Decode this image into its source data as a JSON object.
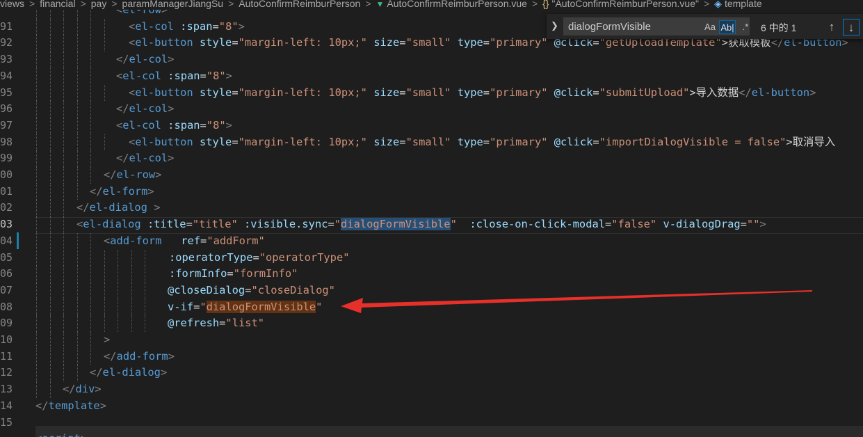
{
  "breadcrumb": {
    "items": [
      "views",
      "financial",
      "pay",
      "paramManagerJiangSu",
      "AutoConfirmReimburPerson",
      "AutoConfirmReimburPerson.vue",
      "\"AutoConfirmReimburPerson.vue\"",
      "template"
    ],
    "separator": ">"
  },
  "gutter": {
    "line_numbers": [
      "91",
      "92",
      "93",
      "94",
      "95",
      "96",
      "97",
      "98",
      "99",
      "00",
      "01",
      "02",
      "03",
      "04",
      "05",
      "06",
      "07",
      "08",
      "09",
      "10",
      "11",
      "12",
      "13",
      "14",
      "15"
    ],
    "active_line": "03"
  },
  "find_widget": {
    "toggle_icon": "chevron-right-icon",
    "query": "dialogFormVisible",
    "match_case_label": "Aa",
    "whole_word_label": "Ab|",
    "regex_label": ".*",
    "result_count": "6 中的 1",
    "prev_icon": "arrow-up-icon",
    "next_icon": "arrow-down-icon"
  },
  "annotation": {
    "type": "red-arrow",
    "color": "#e8302a"
  },
  "code_lines": [
    {
      "tokens": [
        {
          "c": "p",
          "t": "<"
        },
        {
          "c": "t",
          "t": "el-row"
        },
        {
          "c": "p",
          "t": ">"
        }
      ]
    },
    {
      "tokens": [
        {
          "c": "p",
          "t": "<"
        },
        {
          "c": "t",
          "t": "el-col"
        },
        {
          "c": "x",
          "t": " "
        },
        {
          "c": "a",
          "t": ":span"
        },
        {
          "c": "x",
          "t": "="
        },
        {
          "c": "s",
          "t": "\"8\""
        },
        {
          "c": "p",
          "t": ">"
        }
      ]
    },
    {
      "tokens": [
        {
          "c": "p",
          "t": "<"
        },
        {
          "c": "t",
          "t": "el-button"
        },
        {
          "c": "x",
          "t": " "
        },
        {
          "c": "a",
          "t": "style"
        },
        {
          "c": "x",
          "t": "="
        },
        {
          "c": "s",
          "t": "\"margin-left: 10px;\""
        },
        {
          "c": "x",
          "t": " "
        },
        {
          "c": "a",
          "t": "size"
        },
        {
          "c": "x",
          "t": "="
        },
        {
          "c": "s",
          "t": "\"small\""
        },
        {
          "c": "x",
          "t": " "
        },
        {
          "c": "a",
          "t": "type"
        },
        {
          "c": "x",
          "t": "="
        },
        {
          "c": "s",
          "t": "\"primary\""
        },
        {
          "c": "x",
          "t": " "
        },
        {
          "c": "a",
          "t": "@click"
        },
        {
          "c": "x",
          "t": "="
        },
        {
          "c": "s",
          "t": "\"getUploadTemplate\""
        },
        {
          "c": "x",
          "t": ">获取模板"
        },
        {
          "c": "p",
          "t": "</"
        },
        {
          "c": "t",
          "t": "el-button"
        },
        {
          "c": "p",
          "t": ">"
        }
      ]
    },
    {
      "tokens": [
        {
          "c": "p",
          "t": "</"
        },
        {
          "c": "t",
          "t": "el-col"
        },
        {
          "c": "p",
          "t": ">"
        }
      ]
    },
    {
      "tokens": [
        {
          "c": "p",
          "t": "<"
        },
        {
          "c": "t",
          "t": "el-col"
        },
        {
          "c": "x",
          "t": " "
        },
        {
          "c": "a",
          "t": ":span"
        },
        {
          "c": "x",
          "t": "="
        },
        {
          "c": "s",
          "t": "\"8\""
        },
        {
          "c": "p",
          "t": ">"
        }
      ]
    },
    {
      "tokens": [
        {
          "c": "p",
          "t": "<"
        },
        {
          "c": "t",
          "t": "el-button"
        },
        {
          "c": "x",
          "t": " "
        },
        {
          "c": "a",
          "t": "style"
        },
        {
          "c": "x",
          "t": "="
        },
        {
          "c": "s",
          "t": "\"margin-left: 10px;\""
        },
        {
          "c": "x",
          "t": " "
        },
        {
          "c": "a",
          "t": "size"
        },
        {
          "c": "x",
          "t": "="
        },
        {
          "c": "s",
          "t": "\"small\""
        },
        {
          "c": "x",
          "t": " "
        },
        {
          "c": "a",
          "t": "type"
        },
        {
          "c": "x",
          "t": "="
        },
        {
          "c": "s",
          "t": "\"primary\""
        },
        {
          "c": "x",
          "t": " "
        },
        {
          "c": "a",
          "t": "@click"
        },
        {
          "c": "x",
          "t": "="
        },
        {
          "c": "s",
          "t": "\"submitUpload\""
        },
        {
          "c": "x",
          "t": ">导入数据"
        },
        {
          "c": "p",
          "t": "</"
        },
        {
          "c": "t",
          "t": "el-button"
        },
        {
          "c": "p",
          "t": ">"
        }
      ]
    },
    {
      "tokens": [
        {
          "c": "p",
          "t": "</"
        },
        {
          "c": "t",
          "t": "el-col"
        },
        {
          "c": "p",
          "t": ">"
        }
      ]
    },
    {
      "tokens": [
        {
          "c": "p",
          "t": "<"
        },
        {
          "c": "t",
          "t": "el-col"
        },
        {
          "c": "x",
          "t": " "
        },
        {
          "c": "a",
          "t": ":span"
        },
        {
          "c": "x",
          "t": "="
        },
        {
          "c": "s",
          "t": "\"8\""
        },
        {
          "c": "p",
          "t": ">"
        }
      ]
    },
    {
      "tokens": [
        {
          "c": "p",
          "t": "<"
        },
        {
          "c": "t",
          "t": "el-button"
        },
        {
          "c": "x",
          "t": " "
        },
        {
          "c": "a",
          "t": "style"
        },
        {
          "c": "x",
          "t": "="
        },
        {
          "c": "s",
          "t": "\"margin-left: 10px;\""
        },
        {
          "c": "x",
          "t": " "
        },
        {
          "c": "a",
          "t": "size"
        },
        {
          "c": "x",
          "t": "="
        },
        {
          "c": "s",
          "t": "\"small\""
        },
        {
          "c": "x",
          "t": " "
        },
        {
          "c": "a",
          "t": "type"
        },
        {
          "c": "x",
          "t": "="
        },
        {
          "c": "s",
          "t": "\"primary\""
        },
        {
          "c": "x",
          "t": " "
        },
        {
          "c": "a",
          "t": "@click"
        },
        {
          "c": "x",
          "t": "="
        },
        {
          "c": "s",
          "t": "\"importDialogVisible = false\""
        },
        {
          "c": "x",
          "t": ">取消导入"
        }
      ]
    },
    {
      "tokens": [
        {
          "c": "p",
          "t": "</"
        },
        {
          "c": "t",
          "t": "el-col"
        },
        {
          "c": "p",
          "t": ">"
        }
      ]
    },
    {
      "tokens": [
        {
          "c": "p",
          "t": "</"
        },
        {
          "c": "t",
          "t": "el-row"
        },
        {
          "c": "p",
          "t": ">"
        }
      ]
    },
    {
      "tokens": [
        {
          "c": "p",
          "t": "</"
        },
        {
          "c": "t",
          "t": "el-form"
        },
        {
          "c": "p",
          "t": ">"
        }
      ]
    },
    {
      "tokens": [
        {
          "c": "p",
          "t": "</"
        },
        {
          "c": "t",
          "t": "el-dialog"
        },
        {
          "c": "x",
          "t": " "
        },
        {
          "c": "p",
          "t": ">"
        }
      ]
    },
    {
      "tokens": [
        {
          "c": "p",
          "t": "<"
        },
        {
          "c": "t",
          "t": "el-dialog"
        },
        {
          "c": "x",
          "t": " "
        },
        {
          "c": "a",
          "t": ":title"
        },
        {
          "c": "x",
          "t": "="
        },
        {
          "c": "s",
          "t": "\"title\""
        },
        {
          "c": "x",
          "t": " "
        },
        {
          "c": "a",
          "t": ":visible.sync"
        },
        {
          "c": "x",
          "t": "="
        },
        {
          "c": "s",
          "t": "\""
        },
        {
          "c": "s hl",
          "t": "dialogFormVisible"
        },
        {
          "c": "s",
          "t": "\""
        },
        {
          "c": "x",
          "t": "  "
        },
        {
          "c": "a",
          "t": ":close-on-click-modal"
        },
        {
          "c": "x",
          "t": "="
        },
        {
          "c": "s",
          "t": "\"false\""
        },
        {
          "c": "x",
          "t": " "
        },
        {
          "c": "a",
          "t": "v-dialogDrag"
        },
        {
          "c": "x",
          "t": "="
        },
        {
          "c": "s",
          "t": "\"\""
        },
        {
          "c": "p",
          "t": ">"
        }
      ]
    },
    {
      "tokens": [
        {
          "c": "p",
          "t": "<"
        },
        {
          "c": "t",
          "t": "add-form"
        },
        {
          "c": "x",
          "t": "   "
        },
        {
          "c": "a",
          "t": "ref"
        },
        {
          "c": "x",
          "t": "="
        },
        {
          "c": "s",
          "t": "\"addForm\""
        }
      ]
    },
    {
      "tokens": [
        {
          "c": "a",
          "t": ":operatorType"
        },
        {
          "c": "x",
          "t": "="
        },
        {
          "c": "s",
          "t": "\"operatorType\""
        }
      ]
    },
    {
      "tokens": [
        {
          "c": "a",
          "t": ":formInfo"
        },
        {
          "c": "x",
          "t": "="
        },
        {
          "c": "s",
          "t": "\"formInfo\""
        }
      ]
    },
    {
      "tokens": [
        {
          "c": "a",
          "t": "@closeDialog"
        },
        {
          "c": "x",
          "t": "="
        },
        {
          "c": "s",
          "t": "\"closeDialog\""
        }
      ]
    },
    {
      "tokens": [
        {
          "c": "a",
          "t": "v-if"
        },
        {
          "c": "x",
          "t": "="
        },
        {
          "c": "s",
          "t": "\""
        },
        {
          "c": "s hl2",
          "t": "dialogFormVisible"
        },
        {
          "c": "s",
          "t": "\""
        }
      ]
    },
    {
      "tokens": [
        {
          "c": "a",
          "t": "@refresh"
        },
        {
          "c": "x",
          "t": "="
        },
        {
          "c": "s",
          "t": "\"list\""
        }
      ]
    },
    {
      "tokens": [
        {
          "c": "p",
          "t": ">"
        }
      ]
    },
    {
      "tokens": [
        {
          "c": "p",
          "t": "</"
        },
        {
          "c": "t",
          "t": "add-form"
        },
        {
          "c": "p",
          "t": ">"
        }
      ]
    },
    {
      "tokens": [
        {
          "c": "p",
          "t": "</"
        },
        {
          "c": "t",
          "t": "el-dialog"
        },
        {
          "c": "p",
          "t": ">"
        }
      ]
    },
    {
      "tokens": [
        {
          "c": "p",
          "t": "</"
        },
        {
          "c": "t",
          "t": "div"
        },
        {
          "c": "p",
          "t": ">"
        }
      ]
    },
    {
      "tokens": [
        {
          "c": "p",
          "t": "</"
        },
        {
          "c": "t",
          "t": "template"
        },
        {
          "c": "p",
          "t": ">"
        }
      ]
    },
    {
      "tokens": []
    },
    {
      "tokens": [
        {
          "c": "p",
          "t": "<"
        },
        {
          "c": "t",
          "t": "script"
        },
        {
          "c": "p",
          "t": ">"
        }
      ]
    }
  ]
}
